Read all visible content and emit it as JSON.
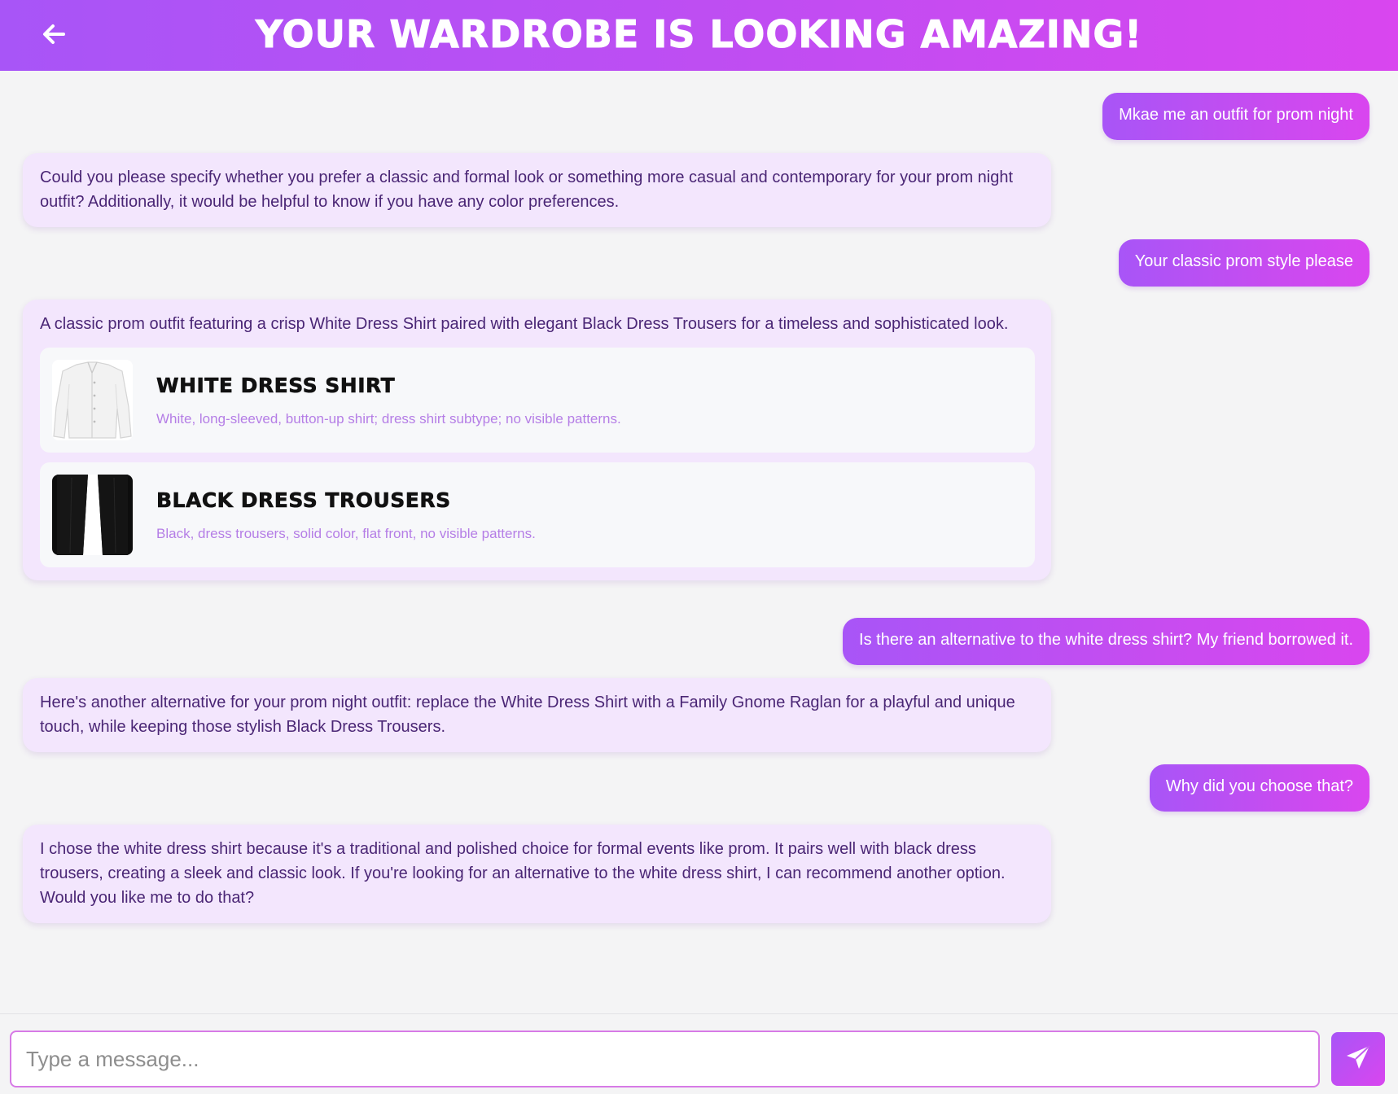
{
  "header": {
    "title": "YOUR WARDROBE IS LOOKING AMAZING!",
    "back_icon": "arrow-left-icon"
  },
  "messages": [
    {
      "role": "user",
      "text": "Mkae me an outfit for prom night"
    },
    {
      "role": "assistant",
      "text": "Could you please specify whether you prefer a classic and formal look or something more casual and contemporary for your prom night outfit? Additionally, it would be helpful to know if you have any color preferences."
    },
    {
      "role": "user",
      "text": "Your classic prom style please"
    },
    {
      "role": "assistant",
      "text": "A classic prom outfit featuring a crisp White Dress Shirt paired with elegant Black Dress Trousers for a timeless and sophisticated look.",
      "items": [
        {
          "title": "WHITE DRESS SHIRT",
          "description": "White, long-sleeved, button-up shirt; dress shirt subtype; no visible patterns."
        },
        {
          "title": "BLACK DRESS TROUSERS",
          "description": "Black, dress trousers, solid color, flat front, no visible patterns."
        }
      ]
    },
    {
      "role": "user",
      "text": "Is there an alternative to the white dress shirt? My friend borrowed it."
    },
    {
      "role": "assistant",
      "text": "Here's another alternative for your prom night outfit: replace the White Dress Shirt with a Family Gnome Raglan for a playful and unique touch, while keeping those stylish Black Dress Trousers."
    },
    {
      "role": "user",
      "text": "Why did you choose that?"
    },
    {
      "role": "assistant",
      "text": "I chose the white dress shirt because it's a traditional and polished choice for formal events like prom. It pairs well with black dress trousers, creating a sleek and classic look. If you're looking for an alternative to the white dress shirt, I can recommend another option. Would you like me to do that?"
    }
  ],
  "composer": {
    "placeholder": "Type a message...",
    "value": "",
    "send_icon": "send-icon"
  },
  "colors": {
    "accent_start": "#a855f7",
    "accent_end": "#d946ef",
    "bot_bubble": "#f3e6fd",
    "bot_text": "#4a2675",
    "item_desc": "#b57ee6",
    "background": "#f4f4f5"
  }
}
